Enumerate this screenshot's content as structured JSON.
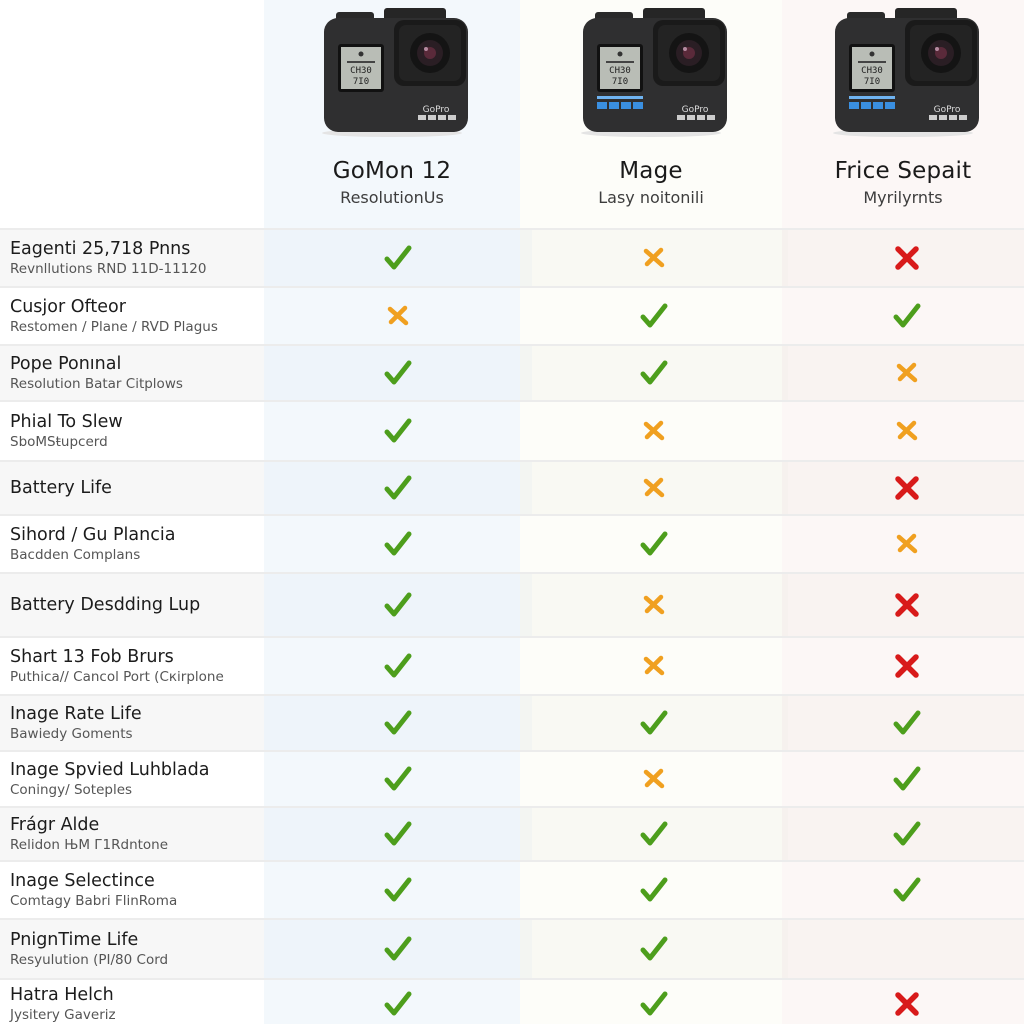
{
  "colors": {
    "yes": "#4d9e1c",
    "partial": "#f0a020",
    "no": "#d81a1a",
    "band_1": "#f3f8fc",
    "band_2": "#fdfdf9",
    "band_3": "#fcf7f6"
  },
  "products": [
    {
      "name": "GoMon 12",
      "subtitle": "ResolutionUs",
      "image": "action-camera-icon"
    },
    {
      "name": "Mage",
      "subtitle": "Lasy noitonili",
      "image": "action-camera-icon"
    },
    {
      "name": "Frice Sepait",
      "subtitle": "Myrilyrnts",
      "image": "action-camera-icon"
    }
  ],
  "features": [
    {
      "title": "Eagenti 25,718 Pnns",
      "desc": "Revnllutions RND 11D-11120",
      "values": [
        "check",
        "partial",
        "cross"
      ]
    },
    {
      "title": "Cusjor Ofteor",
      "desc": "Restomen / Plane / RVD Plagus",
      "values": [
        "partial",
        "check",
        "check"
      ]
    },
    {
      "title": "Pope Ponınal",
      "desc": "Resolution Batar Citplows",
      "values": [
        "check",
        "check",
        "partial"
      ]
    },
    {
      "title": "Phial To Slew",
      "desc": "SboMSŧupcerd",
      "values": [
        "check",
        "partial",
        "partial"
      ]
    },
    {
      "title": "Battery Life",
      "desc": "",
      "values": [
        "check",
        "partial",
        "cross"
      ]
    },
    {
      "title": "Sihord / Gu Plancia",
      "desc": "Bacdden Complans",
      "values": [
        "check",
        "check",
        "partial"
      ]
    },
    {
      "title": "Battery Desdding Lup",
      "desc": "",
      "values": [
        "check",
        "partial",
        "cross"
      ]
    },
    {
      "title": "Shart 13 Fob Brurs",
      "desc": "Puthica// Cancol Port (Cкirplone",
      "values": [
        "check",
        "partial",
        "cross"
      ]
    },
    {
      "title": "Inage Rate Life",
      "desc": "Bawiedy Goments",
      "values": [
        "check",
        "check",
        "check"
      ]
    },
    {
      "title": "Inage Spvied Luhblada",
      "desc": "Coningy/ Soteples",
      "values": [
        "check",
        "partial",
        "check"
      ]
    },
    {
      "title": "Frágr Alde",
      "desc": "Relidon ЊМ Г1Rdntone",
      "values": [
        "check",
        "check",
        "check"
      ]
    },
    {
      "title": "Inage Selectince",
      "desc": "Comtagy Babri FlinRoma",
      "values": [
        "check",
        "check",
        "check"
      ]
    },
    {
      "title": "PnignTime Life",
      "desc": "Resyulution (PI/80 Cord",
      "values": [
        "check",
        "check",
        "none"
      ]
    },
    {
      "title": "Hatra Helch",
      "desc": "Jysitery Gaveriz",
      "values": [
        "check",
        "check",
        "cross"
      ]
    }
  ]
}
